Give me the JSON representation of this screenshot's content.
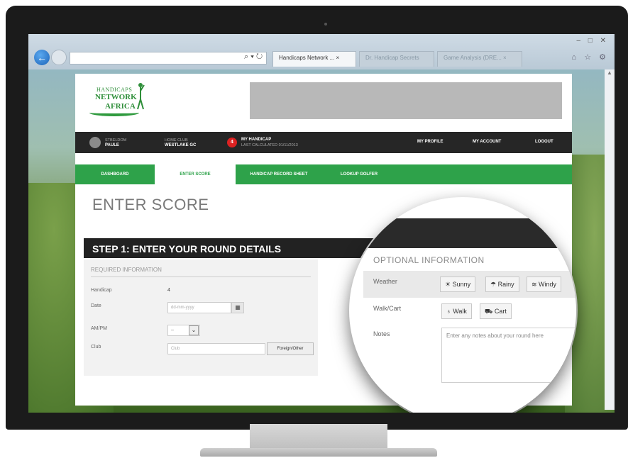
{
  "browser": {
    "tabs": [
      {
        "label": "Handicaps Network ... ×",
        "state": "active"
      },
      {
        "label": "Dr. Handicap Secrets",
        "state": "inactive"
      },
      {
        "label": "Game Analysis (DRE... ×",
        "state": "inactive"
      }
    ],
    "addr_icons": "⌕ ▾ ↻",
    "window_controls": "– □ ✕",
    "toolbar_icons": "⌂ ☆ ⚙"
  },
  "site": {
    "logo": {
      "line1": "HANDICAPS",
      "line2": "NETWORK",
      "line3": "AFRICA"
    }
  },
  "userbar": {
    "golfer_label": "Stbeldom",
    "golfer_name": "Paule",
    "homeclub_label": "Home Club",
    "homeclub_name": "Westlake GC",
    "handicap_value": "4",
    "handicap_label": "My Handicap",
    "handicap_sub": "Last calculated 01/11/2013",
    "links": [
      "My Profile",
      "My Account",
      "Logout"
    ]
  },
  "mainnav": {
    "items": [
      "Dashboard",
      "Enter Score",
      "Handicap Record Sheet",
      "Lookup Golfer"
    ],
    "active_index": 1
  },
  "page": {
    "title": "ENTER SCORE",
    "step_title": "STEP 1: ENTER YOUR ROUND DETAILS"
  },
  "required": {
    "heading": "REQUIRED INFORMATION",
    "handicap_label": "Handicap",
    "handicap_value": "4",
    "date_label": "Date",
    "date_placeholder": "dd-mm-yyyy",
    "ampm_label": "AM/PM",
    "ampm_value": "--",
    "club_label": "Club",
    "club_placeholder": "Club",
    "foreign_button": "Foreign/Other"
  },
  "optional": {
    "heading": "OPTIONAL INFORMATION",
    "weather_label": "Weather",
    "weather_options": [
      "☀ Sunny",
      "☂ Rainy",
      "≋ Windy"
    ],
    "walkcart_label": "Walk/Cart",
    "walkcart_options": [
      "♁ Walk",
      "⛟ Cart"
    ],
    "notes_label": "Notes",
    "notes_placeholder": "Enter any notes about your round here"
  },
  "colors": {
    "brand_green": "#2ea24a",
    "dark_bar": "#262626",
    "badge_red": "#dd2222"
  }
}
